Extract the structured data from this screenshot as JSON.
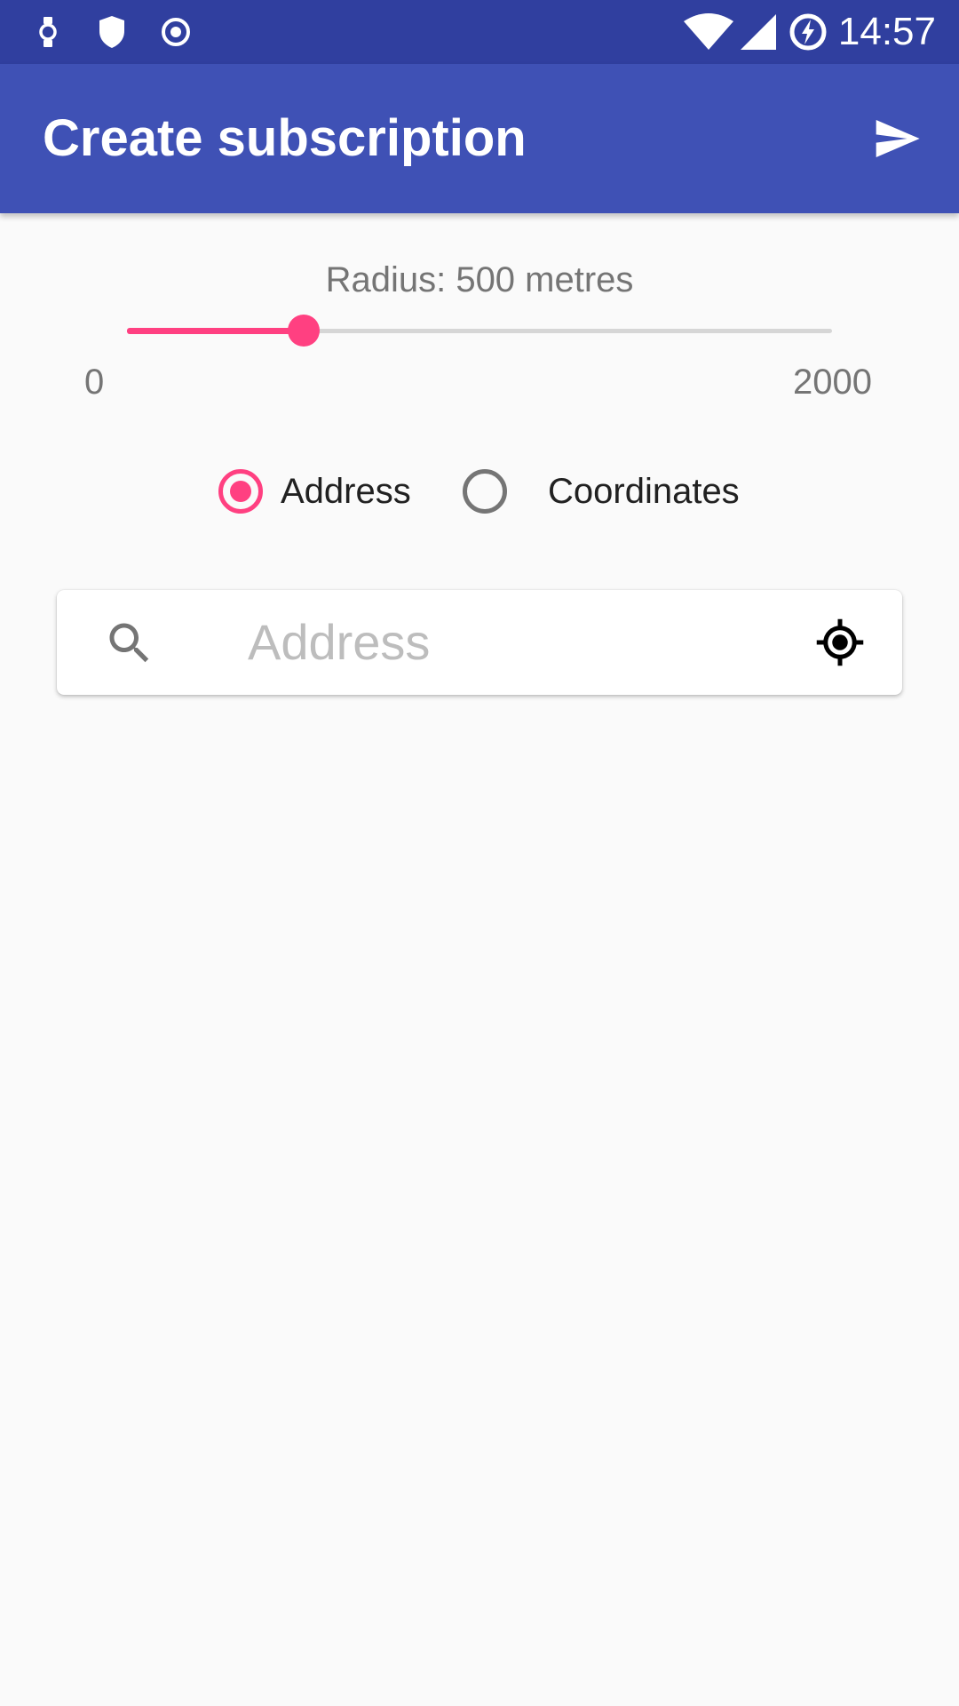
{
  "status_bar": {
    "time": "14:57",
    "icons": [
      "watch-icon",
      "shield-icon",
      "target-icon",
      "wifi-icon",
      "signal-icon",
      "battery-charging-icon"
    ]
  },
  "app_bar": {
    "title": "Create subscription",
    "action_icon": "send-icon"
  },
  "radius": {
    "label": "Radius: 500 metres",
    "value": 500,
    "min": 0,
    "max": 2000,
    "min_label": "0",
    "max_label": "2000"
  },
  "location_mode": {
    "options": [
      {
        "label": "Address",
        "selected": true
      },
      {
        "label": "Coordinates",
        "selected": false
      }
    ]
  },
  "search": {
    "placeholder": "Address",
    "value": "",
    "search_icon": "search-icon",
    "locate_icon": "my-location-icon"
  },
  "colors": {
    "primary": "#3f51b5",
    "primary_dark": "#303f9f",
    "accent": "#ff4081"
  }
}
